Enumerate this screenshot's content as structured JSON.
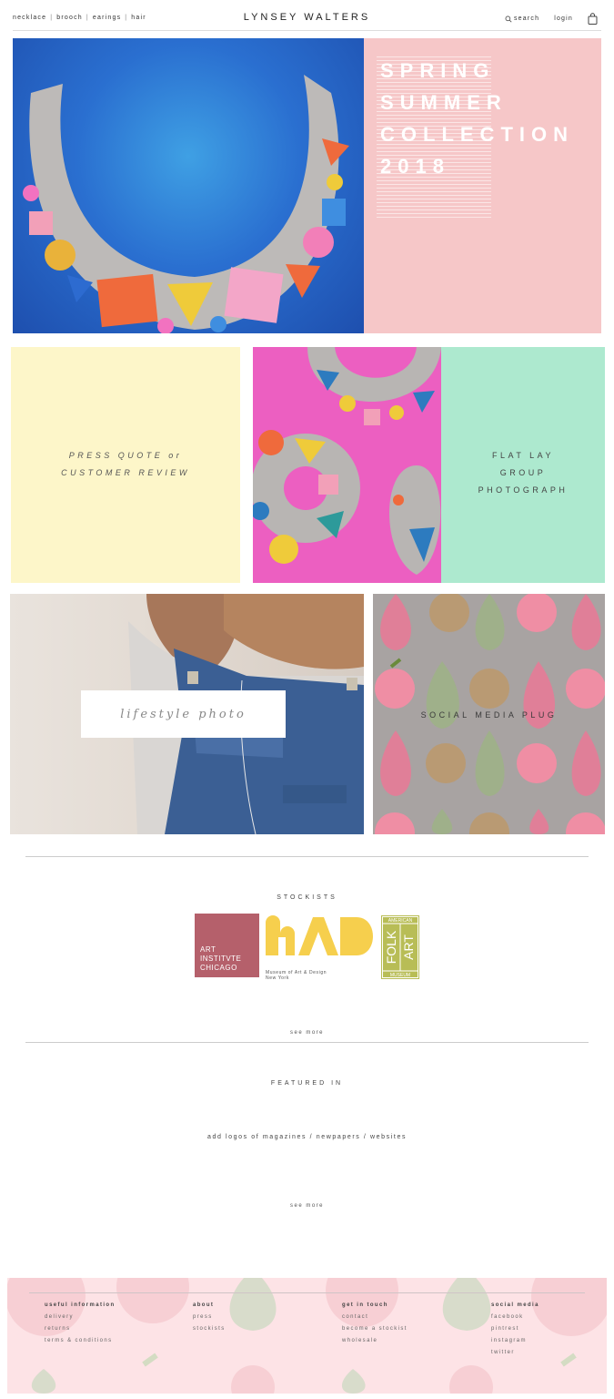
{
  "header": {
    "nav": [
      "necklace",
      "brooch",
      "earings",
      "hair"
    ],
    "brand": "LYNSEY WALTERS",
    "search_label": "search",
    "login_label": "login"
  },
  "hero": {
    "title": "SPRING\nSUMMER\nCOLLECTION\n2018"
  },
  "tiles": {
    "quote": "PRESS QUOTE or\nCUSTOMER REVIEW",
    "flatlay": "FLAT LAY\nGROUP\nPHOTOGRAPH",
    "lifestyle": "lifestyle photo",
    "social": "SOCIAL MEDIA PLUG"
  },
  "stockists": {
    "title": "STOCKISTS",
    "logos": {
      "aic": "ART\nINSTITVTE\nCHICAGO",
      "mad_caption": "Museum of Art & Design\nNew York",
      "afam": [
        "AMERICAN",
        "FOLK",
        "ART",
        "MUSEUM"
      ]
    },
    "see_more": "see more"
  },
  "featured": {
    "title": "FEATURED IN",
    "note": "add logos of magazines / newpapers / websites",
    "see_more": "see more"
  },
  "footer": {
    "columns": [
      {
        "heading": "useful information",
        "items": [
          "delivery",
          "returns",
          "terms & conditions"
        ]
      },
      {
        "heading": "about",
        "items": [
          "press",
          "stockists"
        ]
      },
      {
        "heading": "get in touch",
        "items": [
          "contact",
          "become a stockist",
          "wholesale"
        ]
      },
      {
        "heading": "social media",
        "items": [
          "facebook",
          "pintrest",
          "instagram",
          "twitter"
        ]
      }
    ]
  },
  "colors": {
    "hero_panel": "#f6c7c8",
    "quote_bg": "#fdf6c9",
    "flatlay_bg": "#ade9cf",
    "earrings_bg": "#ec5fc1",
    "social_bg": "#a8a3a2",
    "footer_bg": "#fde3e6"
  }
}
